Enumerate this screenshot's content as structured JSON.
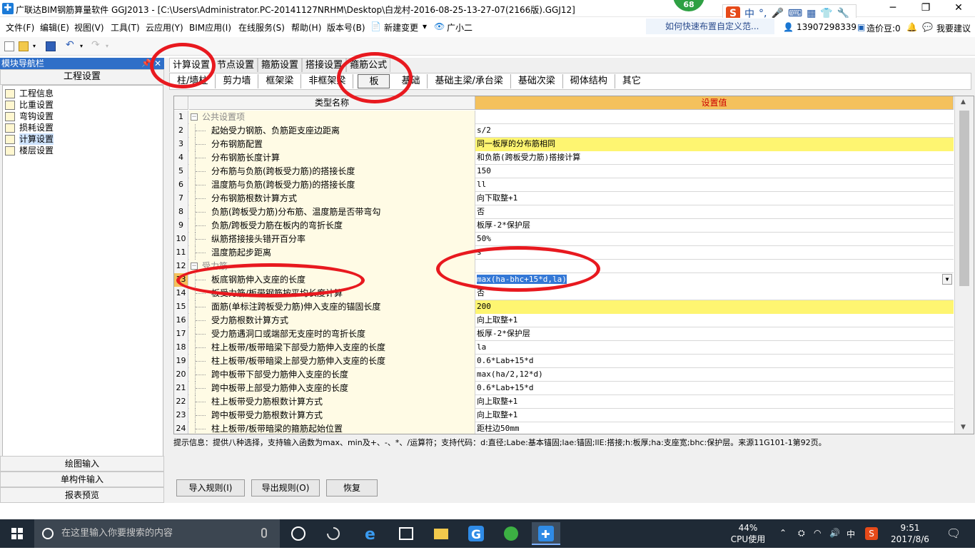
{
  "window": {
    "title": "广联达BIM钢筋算量软件 GGJ2013 - [C:\\Users\\Administrator.PC-20141127NRHM\\Desktop\\白龙村-2016-08-25-13-27-07(2166版).GGJ12]",
    "badge": "68",
    "controls": [
      "─",
      "❐",
      "✕"
    ]
  },
  "ime": {
    "logo": "S",
    "mode": "中",
    "punct": "°,"
  },
  "menu": {
    "items": [
      "文件(F)",
      "编辑(E)",
      "视图(V)",
      "工具(T)",
      "云应用(Y)",
      "BIM应用(I)",
      "在线服务(S)",
      "帮助(H)",
      "版本号(B)",
      "新建变更",
      "广小二"
    ],
    "help_link": "如何快速布置自定义范...",
    "account": "13907298339",
    "cost_bean": "造价豆:0",
    "suggest": "我要建议"
  },
  "left_panel": {
    "header": "模块导航栏",
    "section": "工程设置",
    "tree": [
      "工程信息",
      "比重设置",
      "弯钩设置",
      "损耗设置",
      "计算设置",
      "楼层设置"
    ],
    "selected": 4,
    "bottom": [
      "绘图输入",
      "单构件输入",
      "报表预览"
    ]
  },
  "tabs": [
    "计算设置",
    "节点设置",
    "箍筋设置",
    "搭接设置",
    "箍筋公式"
  ],
  "subtabs": [
    "柱/墙柱",
    "剪力墙",
    "框架梁",
    "非框架梁",
    "板",
    "基础",
    "基础主梁/承台梁",
    "基础次梁",
    "砌体结构",
    "其它"
  ],
  "grid": {
    "col_name": "类型名称",
    "col_value": "设置值",
    "rows": [
      {
        "n": "1",
        "name": "公共设置项",
        "value": "",
        "group": true
      },
      {
        "n": "2",
        "name": "起始受力钢筋、负筋距支座边距离",
        "value": "s/2"
      },
      {
        "n": "3",
        "name": "分布钢筋配置",
        "value": "同一板厚的分布筋相同",
        "yellow": true
      },
      {
        "n": "4",
        "name": "分布钢筋长度计算",
        "value": "和负筋(跨板受力筋)搭接计算"
      },
      {
        "n": "5",
        "name": "分布筋与负筋(跨板受力筋)的搭接长度",
        "value": "150"
      },
      {
        "n": "6",
        "name": "温度筋与负筋(跨板受力筋)的搭接长度",
        "value": "ll"
      },
      {
        "n": "7",
        "name": "分布钢筋根数计算方式",
        "value": "向下取整+1"
      },
      {
        "n": "8",
        "name": "负筋(跨板受力筋)分布筋、温度筋是否带弯勾",
        "value": "否"
      },
      {
        "n": "9",
        "name": "负筋/跨板受力筋在板内的弯折长度",
        "value": "板厚-2*保护层"
      },
      {
        "n": "10",
        "name": "纵筋搭接接头错开百分率",
        "value": "50%"
      },
      {
        "n": "11",
        "name": "温度筋起步距离",
        "value": "s"
      },
      {
        "n": "12",
        "name": "受力筋",
        "value": "",
        "group": true
      },
      {
        "n": "13",
        "name": "板底钢筋伸入支座的长度",
        "value": "max(ha-bhc+15*d,la)",
        "edit": true
      },
      {
        "n": "14",
        "name": "板受力筋/板带钢筋按平均长度计算",
        "value": "否"
      },
      {
        "n": "15",
        "name": "面筋(单标注跨板受力筋)伸入支座的锚固长度",
        "value": "200",
        "yellow": true
      },
      {
        "n": "16",
        "name": "受力筋根数计算方式",
        "value": "向上取整+1"
      },
      {
        "n": "17",
        "name": "受力筋遇洞口或端部无支座时的弯折长度",
        "value": "板厚-2*保护层"
      },
      {
        "n": "18",
        "name": "柱上板带/板带暗梁下部受力筋伸入支座的长度",
        "value": "la"
      },
      {
        "n": "19",
        "name": "柱上板带/板带暗梁上部受力筋伸入支座的长度",
        "value": "0.6*Lab+15*d"
      },
      {
        "n": "20",
        "name": "跨中板带下部受力筋伸入支座的长度",
        "value": "max(ha/2,12*d)"
      },
      {
        "n": "21",
        "name": "跨中板带上部受力筋伸入支座的长度",
        "value": "0.6*Lab+15*d"
      },
      {
        "n": "22",
        "name": "柱上板带受力筋根数计算方式",
        "value": "向上取整+1"
      },
      {
        "n": "23",
        "name": "跨中板带受力筋根数计算方式",
        "value": "向上取整+1"
      },
      {
        "n": "24",
        "name": "柱上板带/板带暗梁的箍筋起始位置",
        "value": "距柱边50mm"
      }
    ]
  },
  "hint": "提示信息：提供八种选择，支持输入函数为max、min及+、-、*、/运算符；支持代码：d:直径;Labe:基本锚固;lae:锚固;llE:搭接;h:板厚;ha:支座宽;bhc:保护层。来源11G101-1第92页。",
  "buttons": [
    "导入规则(I)",
    "导出规则(O)",
    "恢复"
  ],
  "taskbar": {
    "search_placeholder": "在这里输入你要搜索的内容",
    "cpu_percent": "44%",
    "cpu_label": "CPU使用",
    "lang": "中",
    "time": "9:51",
    "date": "2017/8/6"
  },
  "colors": {
    "accent": "#2f6fc8",
    "header_value": "#f4c15c",
    "highlight_row": "#fef571",
    "annotation": "#e8191f"
  }
}
